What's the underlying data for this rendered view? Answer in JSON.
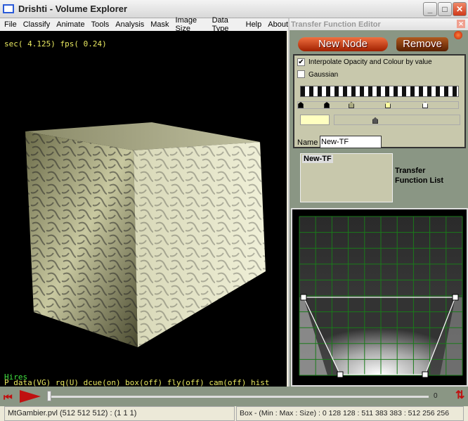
{
  "window": {
    "title": "Drishti - Volume Explorer"
  },
  "menu": [
    "File",
    "Classify",
    "Animate",
    "Tools",
    "Analysis",
    "Mask",
    "Image Size",
    "Data Type",
    "Help",
    "About"
  ],
  "viewport": {
    "top_text": "sec( 4.125) fps( 0.24)",
    "mode_text": "Hires",
    "status_line": "P data(VG) rq(U) dcue(on) box(off) fly(off) cam(off) hist"
  },
  "tf_editor": {
    "title": "Transfer Function Editor",
    "new_node": "New Node",
    "remove": "Remove",
    "interpolate_label": "Interpolate Opacity and Colour by value",
    "interpolate_checked": true,
    "gaussian_label": "Gaussian",
    "gaussian_checked": false,
    "name_label": "Name",
    "name_value": "New-TF",
    "list_items": [
      "New-TF"
    ],
    "list_label": "Transfer Function List",
    "selected_color": "#ffffc0",
    "accent_grid": "#1a7a1a"
  },
  "playback": {
    "frame_value": "0",
    "slider_value": 0
  },
  "statusbar": {
    "left": "MtGambier.pvl (512 512 512) : (1 1 1)",
    "right": "Box - (Min : Max : Size) : 0 128 128 : 511 383 383 : 512 256 256"
  }
}
